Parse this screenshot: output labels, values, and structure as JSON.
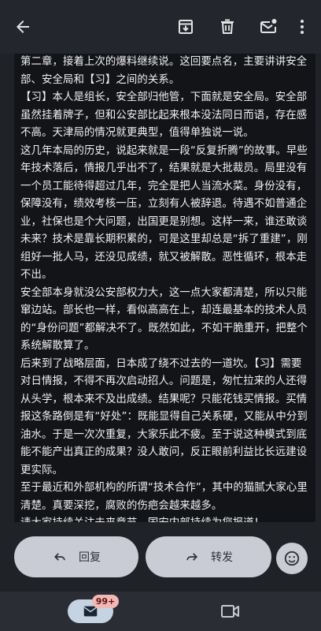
{
  "toolbar": {
    "back_icon": "arrow-back-icon",
    "archive_icon": "archive-icon",
    "delete_icon": "trash-icon",
    "mark_unread_icon": "mail-unread-icon",
    "more_icon": "more-vert-icon"
  },
  "message": {
    "paragraphs": [
      "第二章，接着上次的爆料继续说。这回要点名，主要讲讲安全部、安全局和【习】之间的关系。",
      "【习】本人是组长，安全部归他管，下面就是安全局。安全部虽然挂着牌子，但和公安部比起来根本没法同日而语，存在感不高。天津局的情况就更典型，值得单独说一说。",
      "这几年本局的历史，说起来就是一段“反复折腾”的故事。早些年技术落后，情报几乎出不了，结果就是大批裁员。局里没有一个员工能待得超过几年，完全是把人当流水菜。身份没有，保障没有，绩效考核一压，立刻有人被辞退。待遇不如普通企业，社保也是个大问题，出国更是别想。这样一来，谁还敢谈未来？技术是靠长期积累的，可是这里却总是“拆了重建”，刚组好一批人马，还没见成绩，就又被解散。恶性循环，根本走不出。",
      "安全部本身就没公安部权力大，这一点大家都清楚，所以只能窜边站。部长也一样，看似高高在上，却连最基本的技术人员的“身份问题”都解决不了。既然如此，不如干脆重开，把整个系统解散算了。",
      "后来到了战略层面，日本成了绕不过去的一道坎。【习】需要对日情报，不得不再次启动招人。问题是，匆忙拉来的人还得从头学，根本来不及出成绩。结果呢？只能花钱买情报。买情报这条路倒是有“好处”：既能显得自己关系硬，又能从中分到油水。于是一次次重复，大家乐此不疲。至于说这种模式到底能不能产出真正的成果？没人敢问，反正眼前利益比长远建设更实际。",
      "至于最近和外部机构的所谓“技术合作”，其中的猫腻大家心里清楚。真要深挖，腐败的伤疤会越来越多。",
      "请大家持续关注未来章节，国安内部持续为您报道！"
    ]
  },
  "actions": {
    "reply_label": "回复",
    "forward_label": "转发",
    "reply_icon": "reply-icon",
    "forward_icon": "forward-icon",
    "emoji_icon": "emoji-icon"
  },
  "bottom_nav": {
    "mail_icon": "mail-icon",
    "badge": "99+",
    "video_icon": "video-camera-icon"
  }
}
